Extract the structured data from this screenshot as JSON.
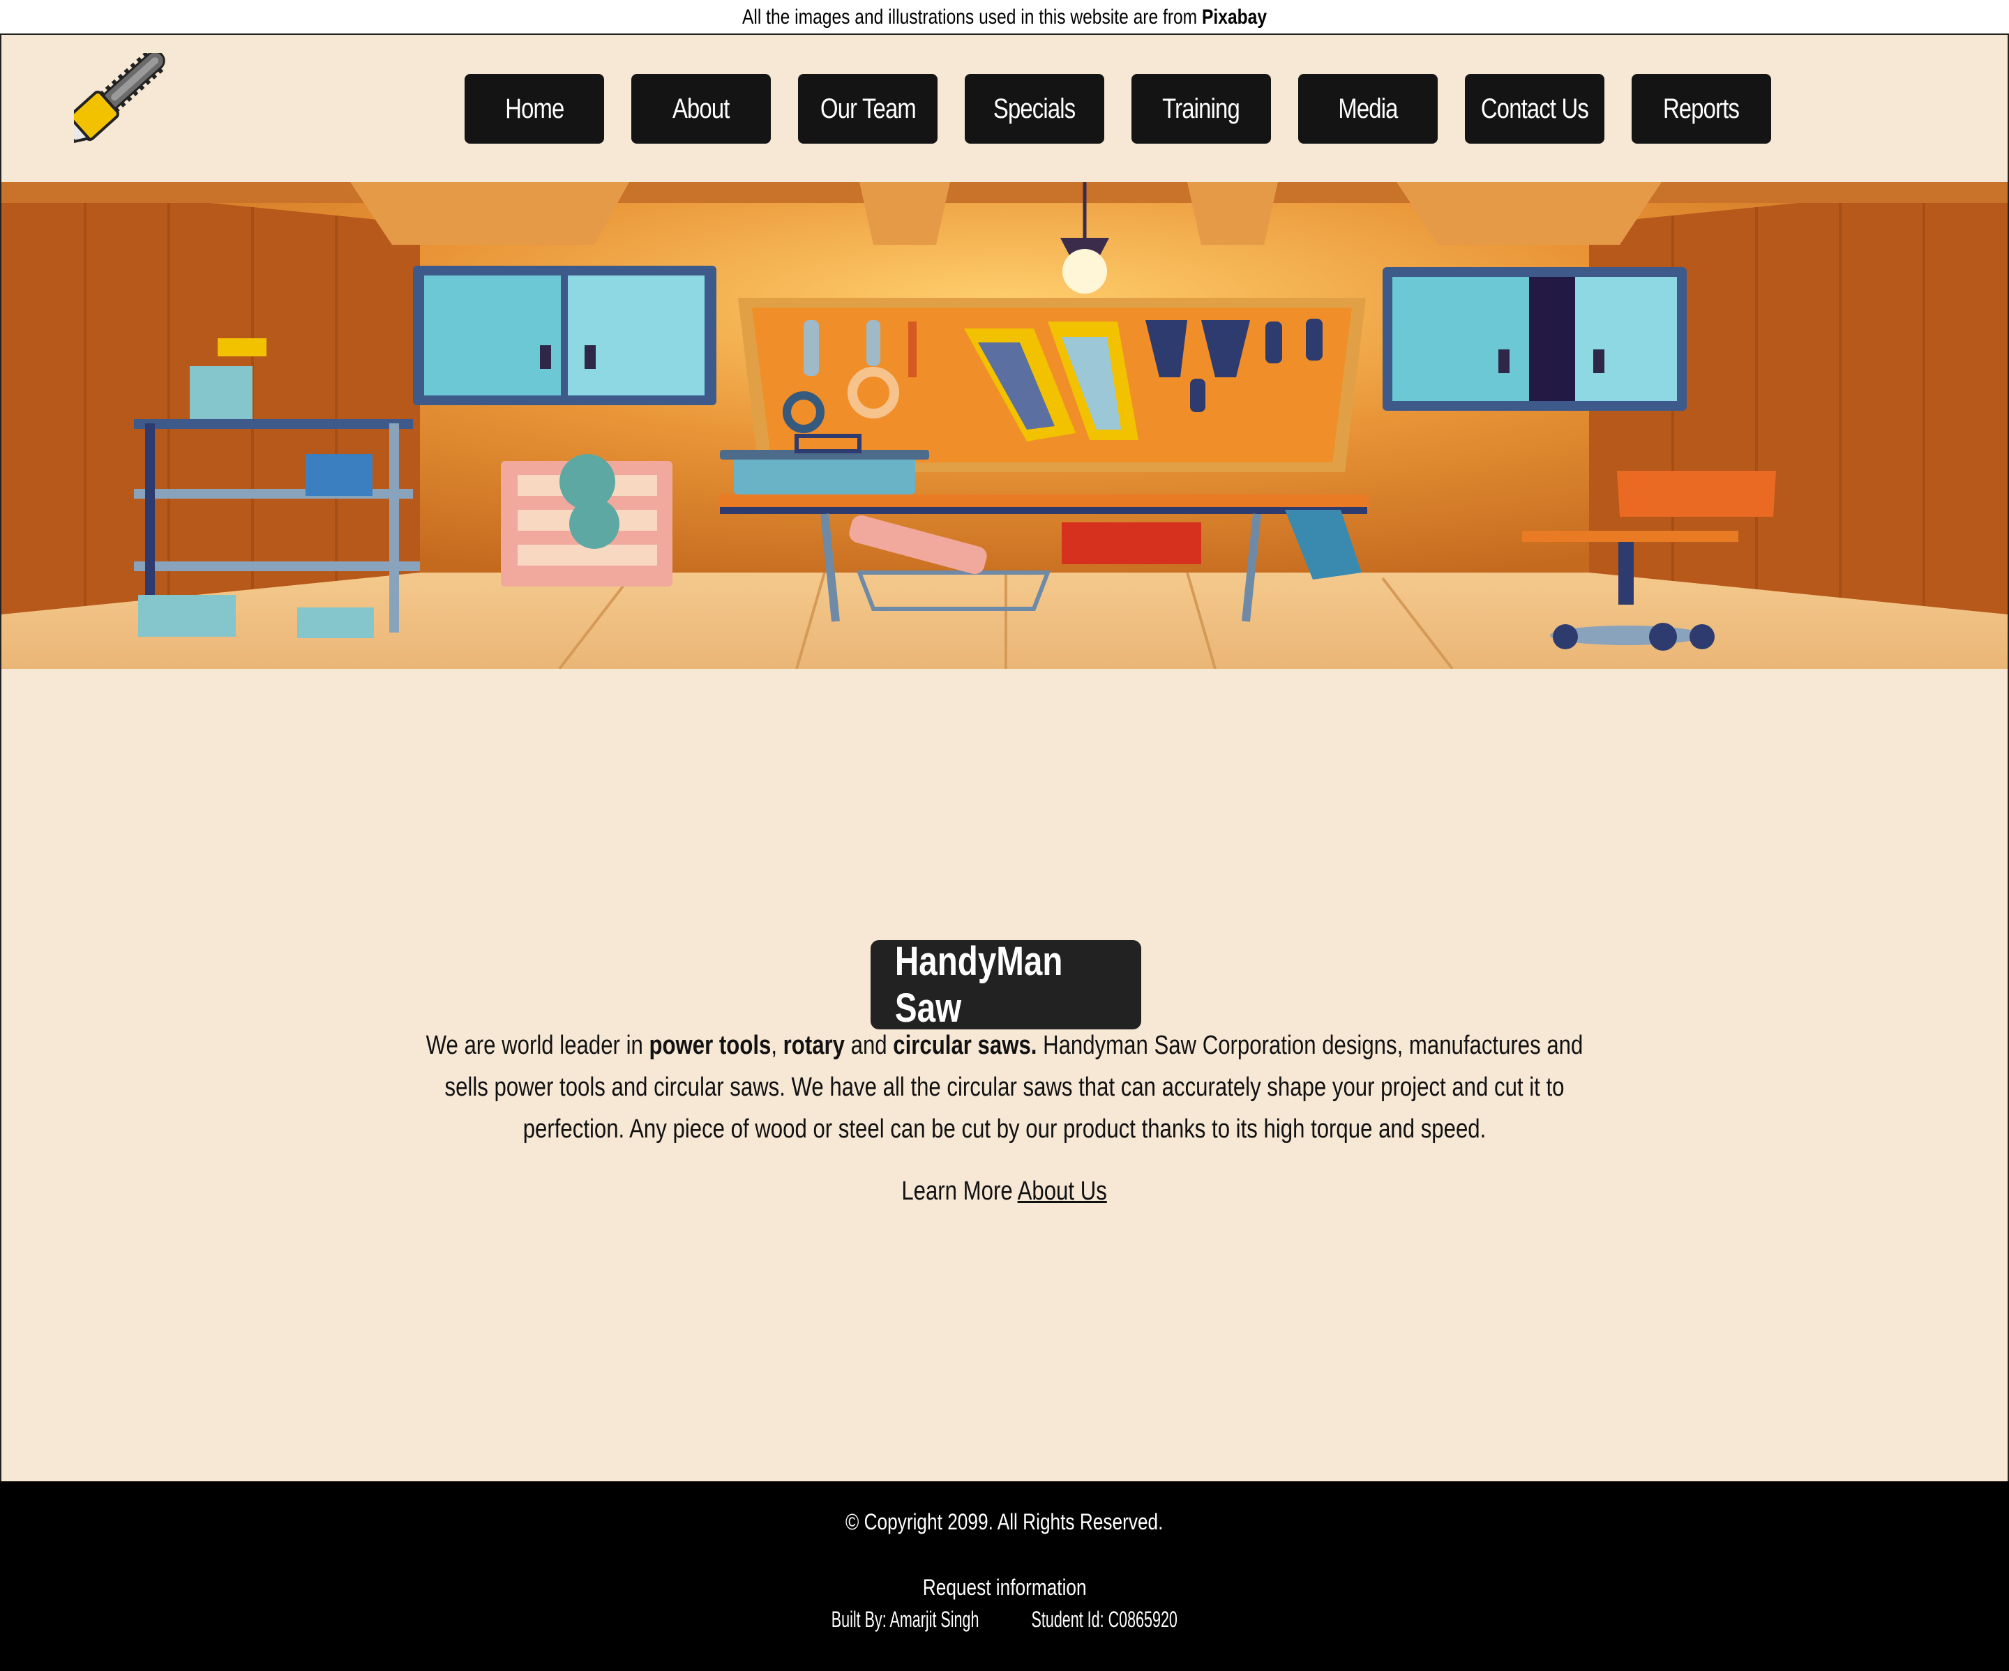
{
  "notice": {
    "text": "All the images and illustrations used in this website are from ",
    "source": "Pixabay"
  },
  "nav": {
    "items": [
      {
        "label": "Home"
      },
      {
        "label": "About"
      },
      {
        "label": "Our Team"
      },
      {
        "label": "Specials"
      },
      {
        "label": "Training"
      },
      {
        "label": "Media"
      },
      {
        "label": "Contact Us"
      },
      {
        "label": "Reports"
      }
    ]
  },
  "hero": {
    "icon": "workshop-illustration"
  },
  "main": {
    "title": "HandyMan Saw",
    "desc_1": "We are world leader in ",
    "desc_b1": "power tools",
    "desc_2": ", ",
    "desc_b2": "rotary",
    "desc_3": " and ",
    "desc_b3": "circular saws.",
    "desc_4": " Handyman Saw Corporation designs, manufactures and sells power tools and circular saws. We have all the circular saws that can accurately shape your project and cut it to perfection. Any piece of wood or steel can be cut by our product thanks to its high torque and speed.",
    "learn_prefix": "Learn More ",
    "learn_link": "About Us"
  },
  "footer": {
    "copyright": "© Copyright 2099. All Rights Reserved.",
    "request": "Request information",
    "built_by": "Built By: Amarjit Singh",
    "student_id": "Student Id: C0865920"
  },
  "colors": {
    "header_bg": "#f7e8d6",
    "nav_bg": "#141414",
    "footer_bg": "#000000",
    "brand_bg": "#222222"
  }
}
